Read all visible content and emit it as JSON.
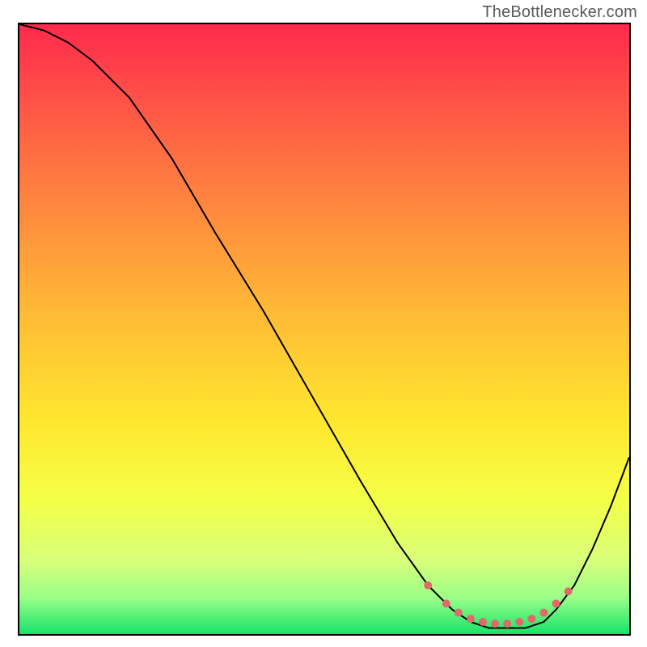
{
  "watermark": "TheBottlenecker.com",
  "chart_data": {
    "type": "line",
    "title": "",
    "xlabel": "",
    "ylabel": "",
    "xlim": [
      0,
      100
    ],
    "ylim": [
      0,
      100
    ],
    "grid": false,
    "legend": false,
    "background": {
      "type": "vertical-gradient",
      "stops": [
        {
          "offset": 0.0,
          "color": "#ff2a4d"
        },
        {
          "offset": 0.2,
          "color": "#ff6a43"
        },
        {
          "offset": 0.45,
          "color": "#ffb437"
        },
        {
          "offset": 0.65,
          "color": "#ffe72e"
        },
        {
          "offset": 0.78,
          "color": "#f4ff47"
        },
        {
          "offset": 0.88,
          "color": "#d7ff7a"
        },
        {
          "offset": 0.94,
          "color": "#9bff88"
        },
        {
          "offset": 1.0,
          "color": "#17e36a"
        }
      ]
    },
    "series": [
      {
        "name": "curve",
        "color": "#000000",
        "x": [
          0,
          4,
          8,
          12,
          18,
          25,
          32,
          40,
          48,
          56,
          62,
          67,
          71,
          74,
          77,
          80,
          83,
          86,
          88,
          91,
          94,
          97,
          100
        ],
        "y": [
          100,
          99,
          97,
          94,
          88,
          78,
          66,
          53,
          39,
          25,
          15,
          8,
          4,
          2,
          1,
          1,
          1,
          2,
          4,
          8,
          14,
          21,
          29
        ]
      }
    ],
    "highlight": {
      "name": "valley-dots",
      "color": "#e06a6a",
      "radius": 5,
      "x": [
        67,
        70,
        72,
        74,
        76,
        78,
        80,
        82,
        84,
        86,
        88,
        90
      ],
      "y": [
        8,
        5,
        3.5,
        2.5,
        2,
        1.7,
        1.7,
        2,
        2.5,
        3.5,
        5,
        7
      ]
    }
  }
}
